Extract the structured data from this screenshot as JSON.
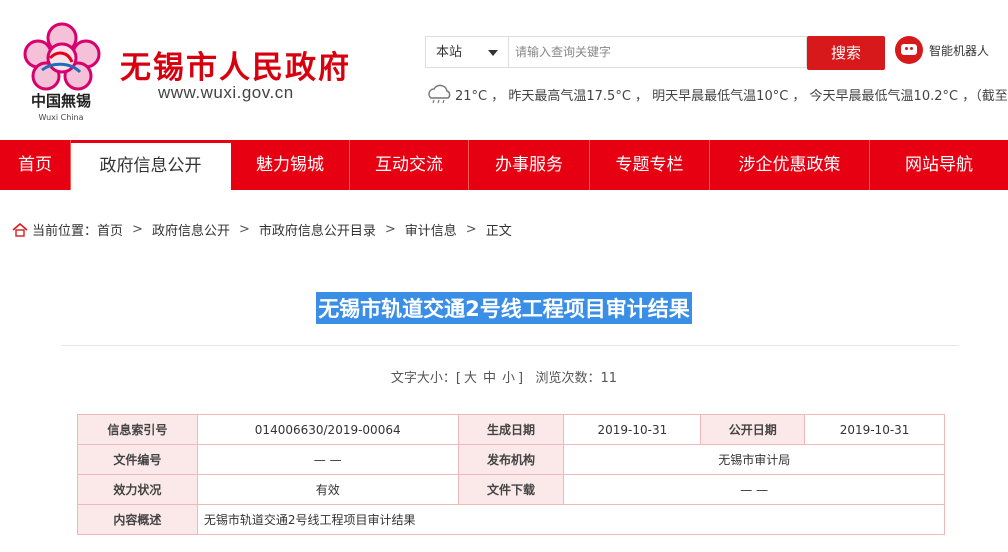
{
  "header": {
    "site_title": "无锡市人民政府",
    "site_url": "www.wuxi.gov.cn",
    "logo_text_cn": "中国無锡",
    "logo_text_en": "Wuxi China",
    "search_scope": "本站",
    "search_placeholder": "请输入查询关键字",
    "search_button": "搜索",
    "robot_label": "智能机器人",
    "weather_text": "21°C ， 昨天最高气温17.5°C ， 明天早晨最低气温10°C ， 今天早晨最低气温10.2°C ，（截至"
  },
  "nav": {
    "items": [
      "首页",
      "政府信息公开",
      "魅力锡城",
      "互动交流",
      "办事服务",
      "专题专栏",
      "涉企优惠政策",
      "网站导航"
    ],
    "active_index": 1
  },
  "breadcrumb": {
    "prefix": "当前位置：",
    "items": [
      "首页",
      "政府信息公开",
      "市政府信息公开目录",
      "审计信息",
      "正文"
    ]
  },
  "article": {
    "title": "无锡市轨道交通2号线工程项目审计结果",
    "font_size_label": "文字大小：[",
    "font_large": "大",
    "font_medium": "中",
    "font_small": "小",
    "font_size_close": "]",
    "views_label": "浏览次数：11"
  },
  "info_table": {
    "index_label": "信息索引号",
    "index_value": "014006630/2019-00064",
    "gen_date_label": "生成日期",
    "gen_date_value": "2019-10-31",
    "pub_date_label": "公开日期",
    "pub_date_value": "2019-10-31",
    "doc_no_label": "文件编号",
    "doc_no_value": "— —",
    "issuer_label": "发布机构",
    "issuer_value": "无锡市审计局",
    "validity_label": "效力状况",
    "validity_value": "有效",
    "download_label": "文件下载",
    "download_value": "— —",
    "summary_label": "内容概述",
    "summary_value": "无锡市轨道交通2号线工程项目审计结果"
  },
  "colors": {
    "brand_red": "#e60012",
    "title_highlight": "#3a8ee6",
    "table_header_bg": "#fbe9e9"
  }
}
